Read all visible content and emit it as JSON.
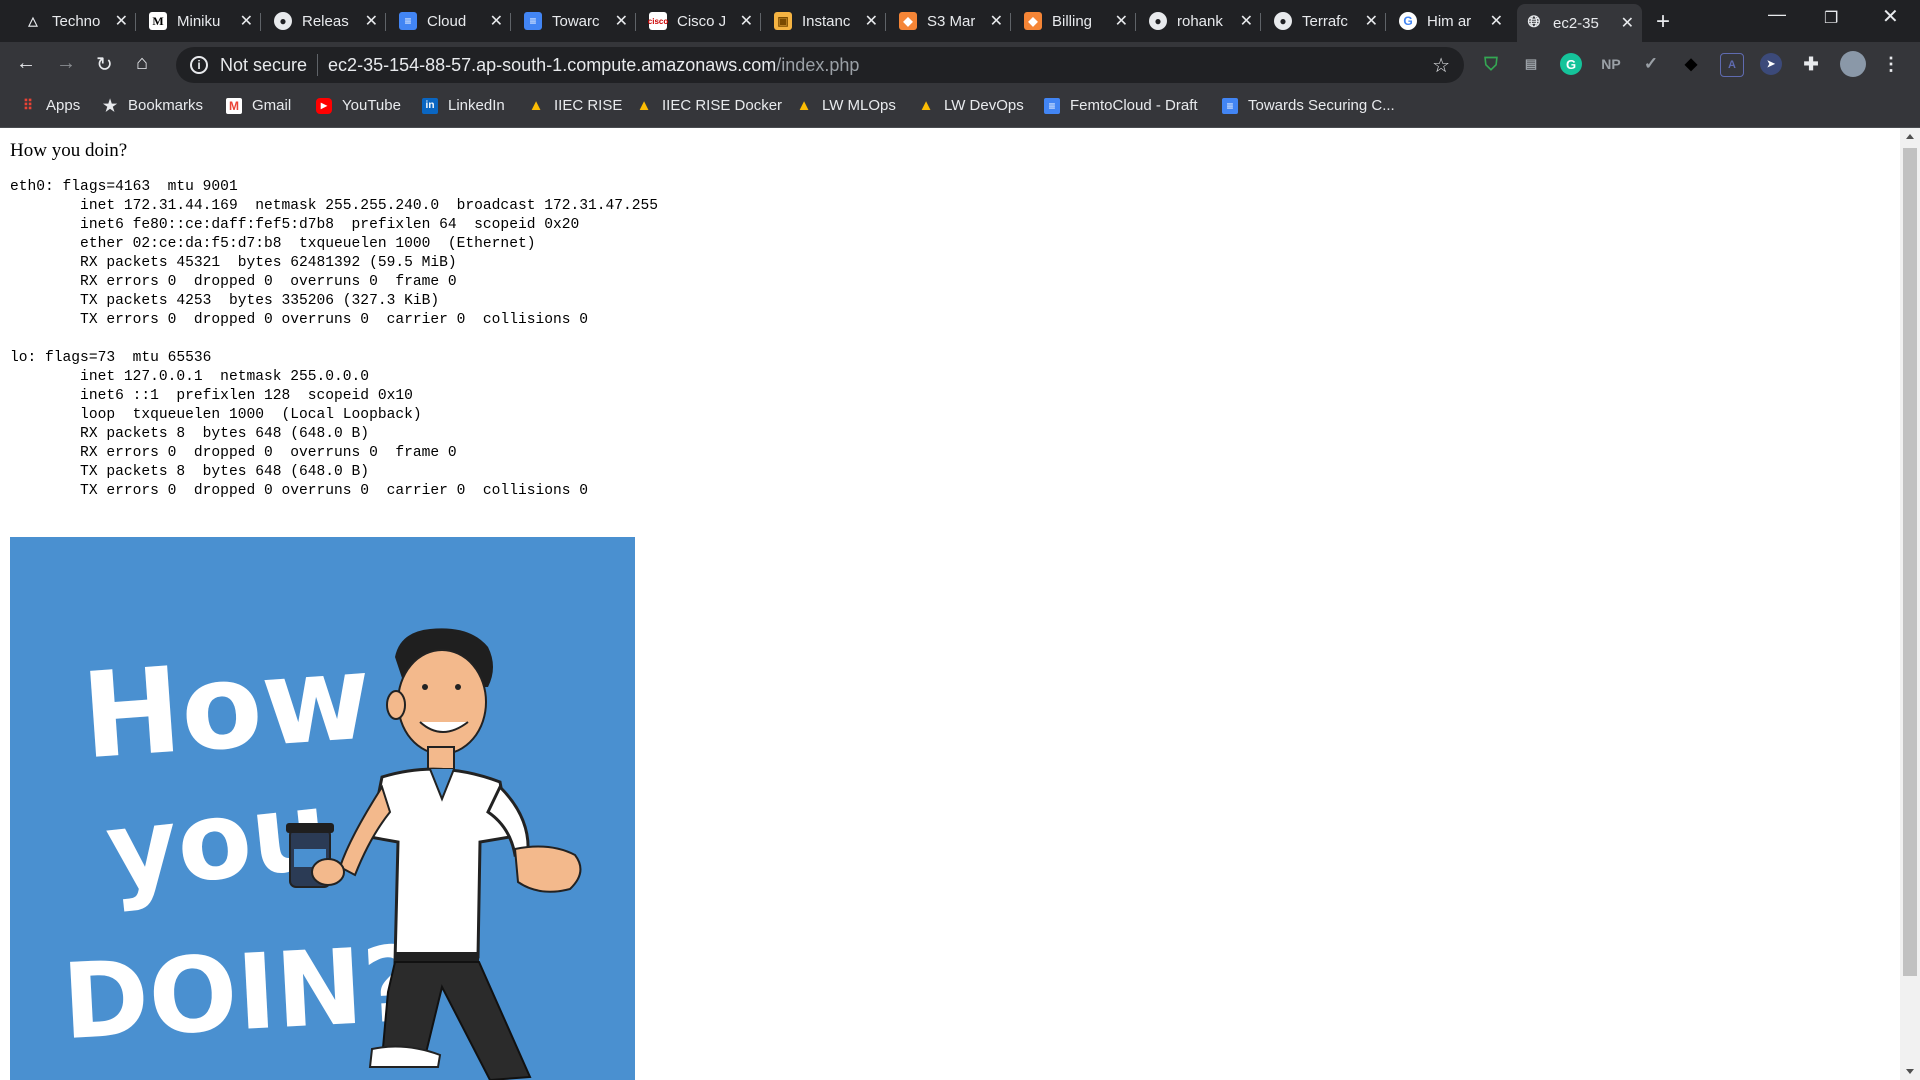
{
  "tabs": [
    {
      "label": "Techno",
      "icon": "triangle-logo-icon"
    },
    {
      "label": "Miniku",
      "icon": "medium-logo-icon"
    },
    {
      "label": "Releas",
      "icon": "github-icon"
    },
    {
      "label": "Cloud",
      "icon": "docs-icon"
    },
    {
      "label": "Towarc",
      "icon": "docs-icon"
    },
    {
      "label": "Cisco J",
      "icon": "cisco-icon"
    },
    {
      "label": "Instanc",
      "icon": "package-icon"
    },
    {
      "label": "S3 Mar",
      "icon": "aws-cube-icon"
    },
    {
      "label": "Billing",
      "icon": "aws-cube-icon"
    },
    {
      "label": "rohank",
      "icon": "github-icon"
    },
    {
      "label": "Terrafc",
      "icon": "github-icon"
    },
    {
      "label": "Him ar",
      "icon": "google-icon"
    },
    {
      "label": "ec2-35",
      "icon": "globe-icon",
      "active": true
    }
  ],
  "omnibox": {
    "security_text": "Not secure",
    "host": "ec2-35-154-88-57.ap-south-1.compute.amazonaws.com",
    "path": "/index.php"
  },
  "extensions": {
    "np_label": "NP"
  },
  "bookmarks": [
    {
      "label": "Apps",
      "icon": "apps-grid-icon"
    },
    {
      "label": "Bookmarks",
      "icon": "star-icon"
    },
    {
      "label": "Gmail",
      "icon": "gmail-icon"
    },
    {
      "label": "YouTube",
      "icon": "youtube-icon"
    },
    {
      "label": "LinkedIn",
      "icon": "linkedin-icon"
    },
    {
      "label": "IIEC RISE",
      "icon": "drive-icon"
    },
    {
      "label": "IIEC RISE Docker",
      "icon": "drive-icon"
    },
    {
      "label": "LW MLOps",
      "icon": "drive-icon"
    },
    {
      "label": "LW DevOps",
      "icon": "drive-icon"
    },
    {
      "label": "FemtoCloud - Draft",
      "icon": "docs-icon"
    },
    {
      "label": "Towards Securing C...",
      "icon": "docs-icon"
    }
  ],
  "page": {
    "greeting": "How you doin?",
    "ifconfig_output": "eth0: flags=4163  mtu 9001\n        inet 172.31.44.169  netmask 255.255.240.0  broadcast 172.31.47.255\n        inet6 fe80::ce:daff:fef5:d7b8  prefixlen 64  scopeid 0x20\n        ether 02:ce:da:f5:d7:b8  txqueuelen 1000  (Ethernet)\n        RX packets 45321  bytes 62481392 (59.5 MiB)\n        RX errors 0  dropped 0  overruns 0  frame 0\n        TX packets 4253  bytes 335206 (327.3 KiB)\n        TX errors 0  dropped 0 overruns 0  carrier 0  collisions 0\n\nlo: flags=73  mtu 65536\n        inet 127.0.0.1  netmask 255.0.0.0\n        inet6 ::1  prefixlen 128  scopeid 0x10\n        loop  txqueuelen 1000  (Local Loopback)\n        RX packets 8  bytes 648 (648.0 B)\n        RX errors 0  dropped 0  overruns 0  frame 0\n        TX packets 8  bytes 648 (648.0 B)\n        TX errors 0  dropped 0 overruns 0  carrier 0  collisions 0",
    "poster": {
      "line1": "How",
      "line2": "you",
      "line3": "DOIN?",
      "background_color": "#4a90d0"
    }
  },
  "colors": {
    "chrome_bg": "#202124",
    "toolbar_bg": "#35363a",
    "text_light": "#e8eaed"
  }
}
